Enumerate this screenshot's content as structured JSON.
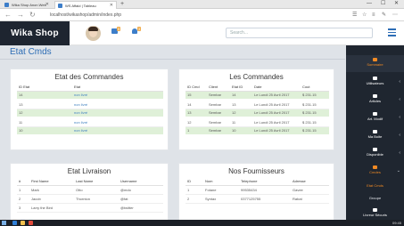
{
  "browser": {
    "tabs": [
      {
        "title": "Wika Shop Anon Web"
      },
      {
        "title": "WS Affaid | Tableau"
      }
    ],
    "new_tab": "+",
    "url": "localhost/wikashop/admin/index.php",
    "controls": {
      "minimize": "—",
      "maximize": "☐",
      "close": "✕"
    }
  },
  "header": {
    "brand": "Wika Shop",
    "notifications": {
      "messages_count": "5",
      "alerts_count": "3"
    },
    "search_placeholder": "Search..."
  },
  "page": {
    "title": "Etat Cmds"
  },
  "panels": {
    "etat_commandes": {
      "title": "Etat des Commandes",
      "columns": [
        "ID Etat",
        "Etat"
      ],
      "rows": [
        {
          "id": "14",
          "etat": "non livré"
        },
        {
          "id": "13",
          "etat": "non livré"
        },
        {
          "id": "12",
          "etat": "non livré"
        },
        {
          "id": "11",
          "etat": "non livré"
        },
        {
          "id": "10",
          "etat": "non livré"
        }
      ]
    },
    "les_commandes": {
      "title": "Les Commandes",
      "columns": [
        "ID Cmd",
        "Client",
        "Etat ID",
        "Date",
        "Cout"
      ],
      "rows": [
        {
          "id": "15",
          "client": "Sembar",
          "etat": "14",
          "date": "Le Lundi 25 Avril 2017",
          "cout": "$ 231.15"
        },
        {
          "id": "14",
          "client": "Sembar",
          "etat": "13",
          "date": "Le Lundi 25 Avril 2017",
          "cout": "$ 231.15"
        },
        {
          "id": "13",
          "client": "Sembar",
          "etat": "12",
          "date": "Le Lundi 25 Avril 2017",
          "cout": "$ 231.15"
        },
        {
          "id": "12",
          "client": "Sembar",
          "etat": "11",
          "date": "Le Lundi 25 Avril 2017",
          "cout": "$ 231.15"
        },
        {
          "id": "1",
          "client": "Sembar",
          "etat": "10",
          "date": "Le Lundi 25 Avril 2017",
          "cout": "$ 231.15"
        }
      ]
    },
    "etat_livraison": {
      "title": "Etat Livraison",
      "columns": [
        "#",
        "First Name",
        "Last Name",
        "Username"
      ],
      "rows": [
        {
          "n": "1",
          "first": "Mark",
          "last": "Otto",
          "user": "@mdo"
        },
        {
          "n": "2",
          "first": "Jacob",
          "last": "Thornton",
          "user": "@fat"
        },
        {
          "n": "3",
          "first": "Larry the Bird",
          "last": "",
          "user": "@twitter"
        }
      ]
    },
    "fournisseurs": {
      "title": "Nos Fournisseurs",
      "columns": [
        "ID",
        "Nom",
        "Telephone",
        "Adresse"
      ],
      "rows": [
        {
          "id": "1",
          "nom": "Fotane",
          "tel": "99535434",
          "adr": "Gavee"
        },
        {
          "id": "2",
          "nom": "Syntax",
          "tel": "0377125755",
          "adr": "Rabat"
        }
      ]
    }
  },
  "sidebar": {
    "home": "Sommaire",
    "items": [
      {
        "label": "Utilisateurs"
      },
      {
        "label": "Articles"
      },
      {
        "label": "Art. Modif"
      },
      {
        "label": "Ma Boite"
      },
      {
        "label": "Disponible"
      },
      {
        "label": "Cmdes"
      }
    ],
    "sub_items": [
      {
        "label": "Etat Cmds"
      },
      {
        "label": "Groupe"
      },
      {
        "label": "Livreur Sécuris"
      }
    ]
  },
  "taskbar": {
    "clock": "09:45"
  },
  "colors": {
    "brand_bg": "#1e2530",
    "accent": "#2d6db5",
    "sidebar_active": "#f08a24",
    "row_highlight": "#dff0d8"
  }
}
